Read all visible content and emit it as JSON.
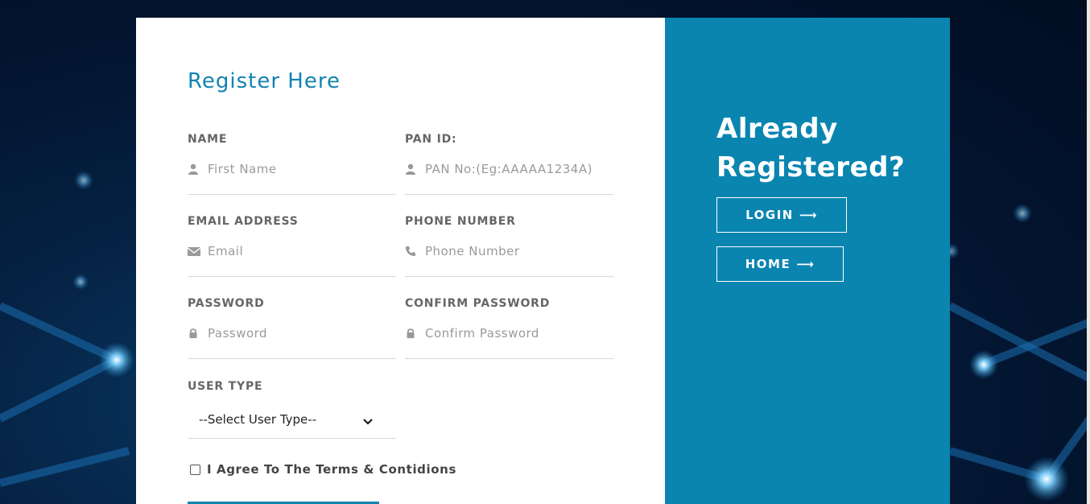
{
  "form": {
    "title": "Register Here",
    "fields": [
      {
        "label": "NAME",
        "placeholder": "First Name",
        "icon": "user-icon"
      },
      {
        "label": "PAN ID:",
        "placeholder": "PAN No:(Eg:AAAAA1234A)",
        "icon": "user-icon"
      },
      {
        "label": "EMAIL ADDRESS",
        "placeholder": "Email",
        "icon": "envelope-icon"
      },
      {
        "label": "PHONE NUMBER",
        "placeholder": "Phone Number",
        "icon": "phone-icon"
      },
      {
        "label": "PASSWORD",
        "placeholder": "Password",
        "icon": "lock-icon"
      },
      {
        "label": "CONFIRM PASSWORD",
        "placeholder": "Confirm Password",
        "icon": "lock-icon"
      }
    ],
    "user_type": {
      "label": "USER TYPE",
      "selected": "--Select User Type--"
    },
    "terms_label": "I Agree To The Terms & Contidions"
  },
  "side": {
    "heading": "Already Registered?",
    "login_label": "LOGIN",
    "home_label": "HOME",
    "arrow": "⟶"
  },
  "colors": {
    "accent": "#1283b0",
    "panel": "#0a85b0"
  }
}
